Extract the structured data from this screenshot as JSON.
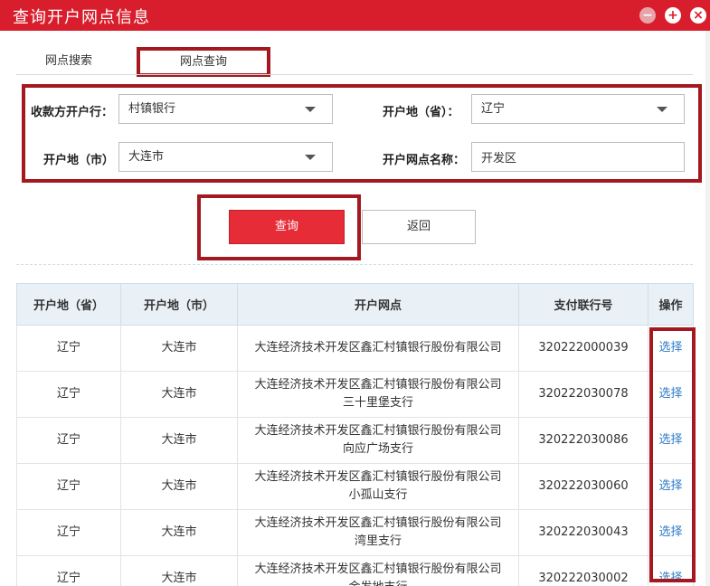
{
  "window": {
    "title": "查询开户网点信息",
    "min_label": "−",
    "max_label": "+",
    "close_label": "×"
  },
  "tabs": [
    {
      "label": "网点搜索"
    },
    {
      "label": "网点查询"
    }
  ],
  "form": {
    "payee_bank_label": "收款方开户行：",
    "payee_bank_value": "村镇银行",
    "province_label": "开户地（省）：",
    "province_value": "辽宁",
    "city_label": "开户地（市）",
    "city_value": "大连市",
    "branch_name_label": "开户网点名称：",
    "branch_name_value": "开发区"
  },
  "buttons": {
    "query": "查询",
    "back": "返回"
  },
  "table": {
    "headers": [
      "开户地（省）",
      "开户地（市）",
      "开户网点",
      "支付联行号",
      "操作"
    ],
    "rows": [
      {
        "province": "辽宁",
        "city": "大连市",
        "branch_line1": "大连经济技术开发区鑫汇村镇银行股份有限公司",
        "branch_line2": "",
        "code": "320222000039",
        "action": "选择"
      },
      {
        "province": "辽宁",
        "city": "大连市",
        "branch_line1": "大连经济技术开发区鑫汇村镇银行股份有限公司",
        "branch_line2": "三十里堡支行",
        "code": "320222030078",
        "action": "选择"
      },
      {
        "province": "辽宁",
        "city": "大连市",
        "branch_line1": "大连经济技术开发区鑫汇村镇银行股份有限公司",
        "branch_line2": "向应广场支行",
        "code": "320222030086",
        "action": "选择"
      },
      {
        "province": "辽宁",
        "city": "大连市",
        "branch_line1": "大连经济技术开发区鑫汇村镇银行股份有限公司",
        "branch_line2": "小孤山支行",
        "code": "320222030060",
        "action": "选择"
      },
      {
        "province": "辽宁",
        "city": "大连市",
        "branch_line1": "大连经济技术开发区鑫汇村镇银行股份有限公司",
        "branch_line2": "湾里支行",
        "code": "320222030043",
        "action": "选择"
      },
      {
        "province": "辽宁",
        "city": "大连市",
        "branch_line1": "大连经济技术开发区鑫汇村镇银行股份有限公司",
        "branch_line2": "金发地支行",
        "code": "320222030002",
        "action": "选择"
      }
    ]
  },
  "colors": {
    "titlebar": "#d81e2c",
    "highlight_border": "#a3191f",
    "query_button": "#e62c37",
    "link": "#2d7bc6",
    "table_header_bg": "#e9f1f7"
  }
}
